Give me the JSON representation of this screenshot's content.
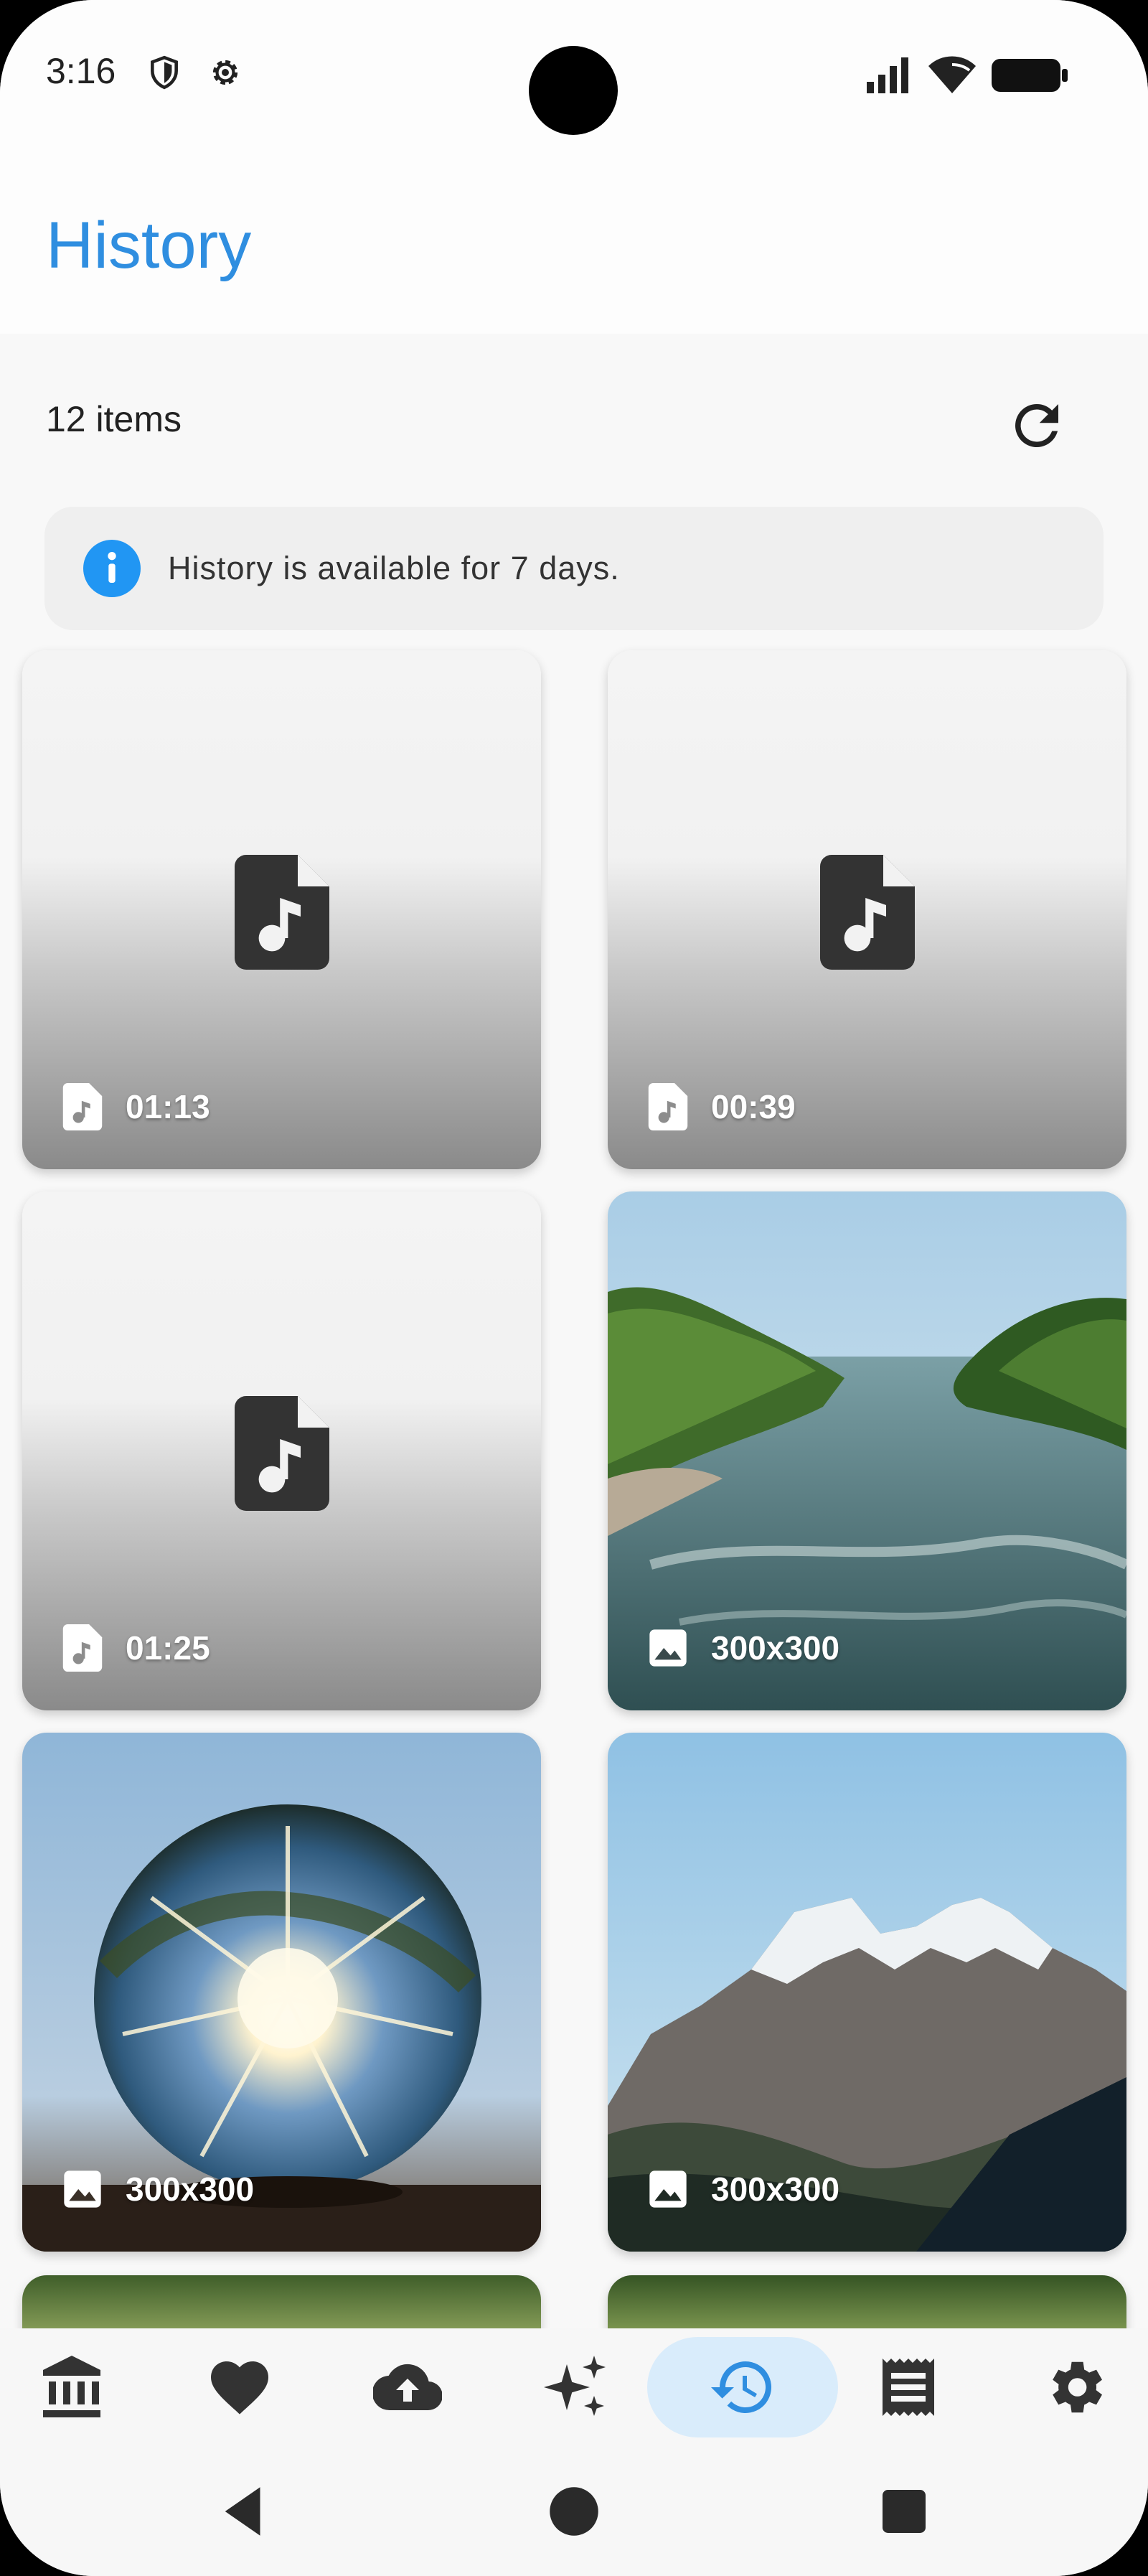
{
  "status_bar": {
    "time": "3:16",
    "icons": [
      "shield-icon",
      "gear-icon",
      "signal-icon",
      "wifi-icon",
      "battery-icon"
    ]
  },
  "app_bar": {
    "title": "History"
  },
  "toolbar": {
    "item_count": "12 items",
    "refresh_icon": "refresh-icon"
  },
  "banner": {
    "icon": "info-icon",
    "text": "History is available for 7 days."
  },
  "items": [
    {
      "type": "audio",
      "icon": "audio-file-icon",
      "label": "01:13"
    },
    {
      "type": "audio",
      "icon": "audio-file-icon",
      "label": "00:39"
    },
    {
      "type": "audio",
      "icon": "audio-file-icon",
      "label": "01:25"
    },
    {
      "type": "image",
      "icon": "image-icon",
      "label": "300x300",
      "scene": "river"
    },
    {
      "type": "image",
      "icon": "image-icon",
      "label": "300x300",
      "scene": "crystal-ball"
    },
    {
      "type": "image",
      "icon": "image-icon",
      "label": "300x300",
      "scene": "mountains"
    }
  ],
  "bottom_nav": {
    "items": [
      "bank-icon",
      "heart-icon",
      "cloud-upload-icon",
      "sparkles-icon",
      "history-icon",
      "receipt-icon",
      "settings-icon"
    ],
    "active": "history-icon"
  },
  "colors": {
    "accent": "#2f8ee0",
    "active_pill": "#d9ecfb",
    "info_blue": "#2196f3"
  }
}
